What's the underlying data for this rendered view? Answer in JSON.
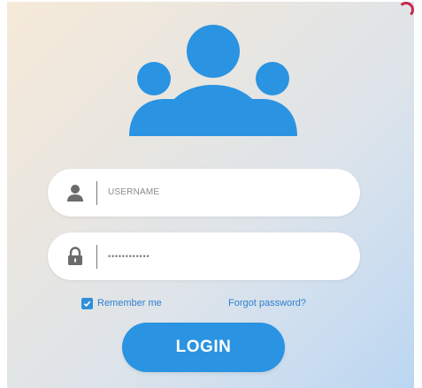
{
  "login": {
    "username_placeholder": "USERNAME",
    "password_value": "••••••••••••",
    "remember_label": "Remember me",
    "remember_checked": true,
    "forgot_label": "Forgot password?",
    "login_label": "LOGIN"
  },
  "icons": {
    "hero": "users-group-icon",
    "username": "user-icon",
    "password": "lock-icon",
    "checkbox": "checkmark-icon"
  },
  "colors": {
    "accent": "#2a93e2",
    "link": "#2f7fcf",
    "field_bg": "#ffffff",
    "icon_gray": "#6b6b6b"
  }
}
